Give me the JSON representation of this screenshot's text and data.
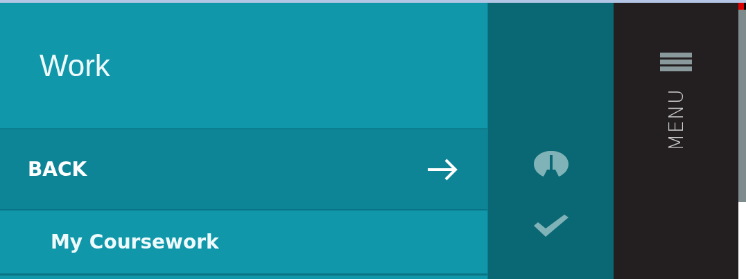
{
  "panel": {
    "title": "Work",
    "back": {
      "label": "BACK"
    },
    "items": [
      {
        "label": "My Coursework"
      }
    ]
  },
  "menu": {
    "label": "MENU"
  }
}
